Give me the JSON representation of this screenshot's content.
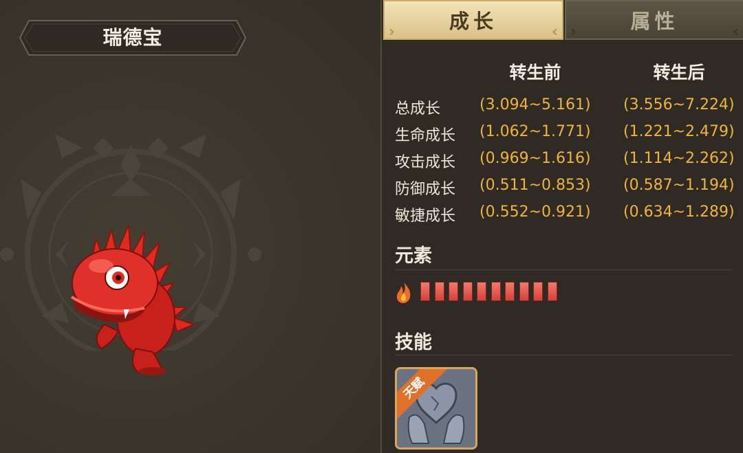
{
  "pet": {
    "name": "瑞德宝"
  },
  "tabs": [
    {
      "label": "成长",
      "active": true
    },
    {
      "label": "属性",
      "active": false
    }
  ],
  "growth": {
    "headers": [
      "转生前",
      "转生后"
    ],
    "rows": [
      {
        "label": "总成长",
        "before": "(3.094~5.161)",
        "after": "(3.556~7.224)"
      },
      {
        "label": "生命成长",
        "before": "(1.062~1.771)",
        "after": "(1.221~2.479)"
      },
      {
        "label": "攻击成长",
        "before": "(0.969~1.616)",
        "after": "(1.114~2.262)"
      },
      {
        "label": "防御成长",
        "before": "(0.511~0.853)",
        "after": "(0.587~1.194)"
      },
      {
        "label": "敏捷成长",
        "before": "(0.552~0.921)",
        "after": "(0.634~1.289)"
      }
    ]
  },
  "element": {
    "title": "元素",
    "icon": "fire-icon",
    "color": "#e8453c",
    "segments_filled": 10
  },
  "skills": {
    "title": "技能",
    "items": [
      {
        "badge": "天赋",
        "icon": "stone-heart-hands-icon"
      }
    ]
  },
  "colors": {
    "accent": "#f0b33c",
    "tab_active": "#f4e4b4",
    "panel": "#2f2b24"
  }
}
